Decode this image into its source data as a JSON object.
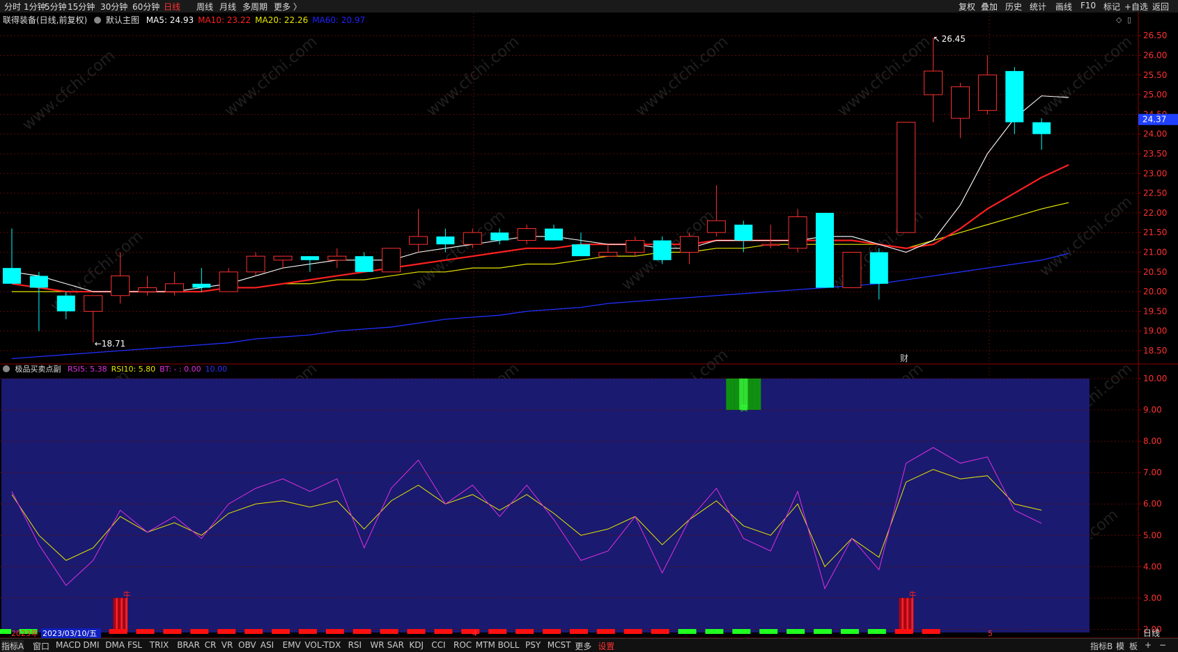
{
  "top_toolbar": {
    "periods": [
      "分时",
      "1分钟",
      "5分钟",
      "15分钟",
      "30分钟",
      "60分钟",
      "日线",
      "周线",
      "月线",
      "多周期",
      "更多 〉"
    ],
    "active_period": "日线",
    "right_tools": [
      "复权",
      "叠加",
      "历史",
      "统计",
      "画线",
      "F10",
      "标记",
      "+自选",
      "返回"
    ]
  },
  "main_panel": {
    "title": "联得装备(日线,前复权)",
    "indicator_name": "默认主图",
    "ma": [
      {
        "label": "MA5: 24.93",
        "color": "#ffffff"
      },
      {
        "label": "MA10: 23.22",
        "color": "#ff2020"
      },
      {
        "label": "MA20: 22.26",
        "color": "#e8e800"
      },
      {
        "label": "MA60: 20.97",
        "color": "#2020ff"
      }
    ],
    "high_label": "26.45",
    "low_label": "18.71",
    "price_tag": "24.37",
    "event_marker": "财",
    "y_ticks": [
      "26.50",
      "26.00",
      "25.50",
      "25.00",
      "24.50",
      "24.00",
      "23.50",
      "23.00",
      "22.50",
      "22.00",
      "21.50",
      "21.00",
      "20.50",
      "20.00",
      "19.50",
      "19.00",
      "18.50"
    ]
  },
  "sub_panel": {
    "title": "极品买卖点副",
    "values": [
      {
        "label": "RSI5: 5.38",
        "color": "#e030e0"
      },
      {
        "label": "RSI10: 5.80",
        "color": "#e8e800"
      },
      {
        "label": "BT: - : 0.00",
        "color": "#e030e0"
      },
      {
        "label": "10.00",
        "color": "#3030ff"
      }
    ],
    "y_ticks": [
      "10.00",
      "9.00",
      "8.00",
      "7.00",
      "6.00",
      "5.00",
      "4.00",
      "3.00",
      "2.00"
    ],
    "signal_labels": [
      "牛",
      "牛",
      "卖"
    ]
  },
  "time_axis": {
    "year": "2023年",
    "date": "2023/03/10/五",
    "month_marks": [
      "4",
      "5"
    ],
    "period_label": "日线"
  },
  "bottom_tabs": [
    "指标A",
    "窗口",
    "MACD",
    "DMI",
    "DMA",
    "FSL",
    "TRIX",
    "BRAR",
    "CR",
    "VR",
    "OBV",
    "ASI",
    "EMV",
    "VOL-TDX",
    "RSI",
    "WR",
    "SAR",
    "KDJ",
    "CCI",
    "ROC",
    "MTM",
    "BOLL",
    "PSY",
    "MCST",
    "更多",
    "设置"
  ],
  "bottom_right": [
    "指标B",
    "模",
    "板",
    "+",
    "−"
  ],
  "watermark": "www.cfchi.com",
  "chart_data": {
    "type": "candlestick",
    "dates_visible": [
      "2023/03/10"
    ],
    "candles": [
      {
        "o": 20.6,
        "h": 21.6,
        "l": 20.3,
        "c": 20.2
      },
      {
        "o": 20.4,
        "h": 20.5,
        "l": 19.0,
        "c": 20.1
      },
      {
        "o": 19.9,
        "h": 20.0,
        "l": 19.3,
        "c": 19.5
      },
      {
        "o": 19.5,
        "h": 19.9,
        "l": 18.71,
        "c": 19.9
      },
      {
        "o": 19.9,
        "h": 21.0,
        "l": 19.7,
        "c": 20.4
      },
      {
        "o": 20.0,
        "h": 20.4,
        "l": 19.9,
        "c": 20.1
      },
      {
        "o": 20.0,
        "h": 20.5,
        "l": 19.9,
        "c": 20.2
      },
      {
        "o": 20.2,
        "h": 20.6,
        "l": 20.0,
        "c": 20.1
      },
      {
        "o": 20.0,
        "h": 20.6,
        "l": 20.0,
        "c": 20.5
      },
      {
        "o": 20.5,
        "h": 21.0,
        "l": 20.4,
        "c": 20.9
      },
      {
        "o": 20.8,
        "h": 20.9,
        "l": 20.6,
        "c": 20.9
      },
      {
        "o": 20.9,
        "h": 20.9,
        "l": 20.5,
        "c": 20.8
      },
      {
        "o": 20.8,
        "h": 21.1,
        "l": 20.6,
        "c": 20.9
      },
      {
        "o": 20.9,
        "h": 21.0,
        "l": 20.5,
        "c": 20.5
      },
      {
        "o": 20.5,
        "h": 21.1,
        "l": 20.5,
        "c": 21.1
      },
      {
        "o": 21.2,
        "h": 22.1,
        "l": 21.0,
        "c": 21.4
      },
      {
        "o": 21.4,
        "h": 21.6,
        "l": 21.0,
        "c": 21.2
      },
      {
        "o": 21.2,
        "h": 21.6,
        "l": 21.1,
        "c": 21.5
      },
      {
        "o": 21.5,
        "h": 21.6,
        "l": 21.2,
        "c": 21.3
      },
      {
        "o": 21.3,
        "h": 21.7,
        "l": 21.2,
        "c": 21.6
      },
      {
        "o": 21.6,
        "h": 21.7,
        "l": 21.3,
        "c": 21.3
      },
      {
        "o": 21.2,
        "h": 21.5,
        "l": 20.9,
        "c": 20.9
      },
      {
        "o": 20.9,
        "h": 21.2,
        "l": 20.9,
        "c": 21.0
      },
      {
        "o": 21.0,
        "h": 21.4,
        "l": 20.9,
        "c": 21.3
      },
      {
        "o": 21.3,
        "h": 21.4,
        "l": 20.7,
        "c": 20.8
      },
      {
        "o": 21.0,
        "h": 21.5,
        "l": 20.7,
        "c": 21.4
      },
      {
        "o": 21.5,
        "h": 22.7,
        "l": 21.4,
        "c": 21.8
      },
      {
        "o": 21.7,
        "h": 21.8,
        "l": 21.0,
        "c": 21.3
      },
      {
        "o": 21.2,
        "h": 21.7,
        "l": 21.1,
        "c": 21.2
      },
      {
        "o": 21.1,
        "h": 22.1,
        "l": 21.0,
        "c": 21.9
      },
      {
        "o": 22.0,
        "h": 22.0,
        "l": 20.1,
        "c": 20.1
      },
      {
        "o": 20.1,
        "h": 21.0,
        "l": 20.1,
        "c": 21.0
      },
      {
        "o": 21.0,
        "h": 21.1,
        "l": 19.8,
        "c": 20.2
      },
      {
        "o": 21.5,
        "h": 24.3,
        "l": 21.5,
        "c": 24.3
      },
      {
        "o": 25.0,
        "h": 26.45,
        "l": 24.3,
        "c": 25.6
      },
      {
        "o": 24.4,
        "h": 25.3,
        "l": 23.9,
        "c": 25.2
      },
      {
        "o": 24.6,
        "h": 26.0,
        "l": 24.5,
        "c": 25.5
      },
      {
        "o": 25.6,
        "h": 25.7,
        "l": 24.0,
        "c": 24.3
      },
      {
        "o": 24.3,
        "h": 24.4,
        "l": 23.6,
        "c": 24.0
      }
    ],
    "ma5": [
      20.5,
      20.4,
      20.2,
      20.0,
      20.0,
      20.0,
      20.0,
      20.1,
      20.2,
      20.4,
      20.6,
      20.7,
      20.8,
      20.8,
      20.8,
      21.0,
      21.1,
      21.2,
      21.3,
      21.4,
      21.4,
      21.3,
      21.2,
      21.2,
      21.1,
      21.1,
      21.3,
      21.3,
      21.3,
      21.3,
      21.4,
      21.4,
      21.2,
      21.0,
      21.3,
      22.2,
      23.5,
      24.4,
      24.97,
      24.93
    ],
    "ma10": [
      20.2,
      20.1,
      20.0,
      20.0,
      20.0,
      20.0,
      20.0,
      20.0,
      20.1,
      20.1,
      20.2,
      20.3,
      20.4,
      20.5,
      20.6,
      20.7,
      20.8,
      20.9,
      21.0,
      21.1,
      21.1,
      21.2,
      21.2,
      21.2,
      21.2,
      21.2,
      21.3,
      21.3,
      21.3,
      21.3,
      21.3,
      21.3,
      21.2,
      21.1,
      21.2,
      21.6,
      22.1,
      22.5,
      22.9,
      23.22
    ],
    "ma20": [
      20.0,
      20.0,
      20.0,
      20.0,
      20.0,
      20.0,
      20.0,
      20.0,
      20.1,
      20.1,
      20.2,
      20.2,
      20.3,
      20.3,
      20.4,
      20.5,
      20.5,
      20.6,
      20.6,
      20.7,
      20.7,
      20.8,
      20.9,
      20.9,
      21.0,
      21.0,
      21.1,
      21.1,
      21.2,
      21.2,
      21.2,
      21.2,
      21.2,
      21.1,
      21.3,
      21.5,
      21.7,
      21.9,
      22.1,
      22.26
    ],
    "ma60": [
      18.3,
      18.35,
      18.4,
      18.45,
      18.5,
      18.55,
      18.6,
      18.65,
      18.7,
      18.8,
      18.85,
      18.9,
      19.0,
      19.05,
      19.1,
      19.2,
      19.3,
      19.35,
      19.4,
      19.5,
      19.55,
      19.6,
      19.7,
      19.75,
      19.8,
      19.85,
      19.9,
      19.95,
      20.0,
      20.05,
      20.1,
      20.15,
      20.2,
      20.3,
      20.4,
      20.5,
      20.6,
      20.7,
      20.8,
      20.97
    ],
    "rsi5": [
      6.4,
      4.7,
      3.4,
      4.2,
      5.8,
      5.1,
      5.6,
      4.9,
      6.0,
      6.5,
      6.8,
      6.4,
      6.8,
      4.6,
      6.5,
      7.4,
      6.0,
      6.6,
      5.6,
      6.6,
      5.5,
      4.2,
      4.5,
      5.6,
      3.8,
      5.5,
      6.5,
      4.9,
      4.5,
      6.4,
      3.3,
      4.9,
      3.9,
      7.3,
      7.8,
      7.3,
      7.5,
      5.8,
      5.38
    ],
    "rsi10": [
      6.3,
      5.0,
      4.2,
      4.6,
      5.6,
      5.1,
      5.4,
      5.0,
      5.7,
      6.0,
      6.1,
      5.9,
      6.1,
      5.2,
      6.1,
      6.6,
      6.0,
      6.3,
      5.8,
      6.3,
      5.7,
      5.0,
      5.2,
      5.6,
      4.7,
      5.5,
      6.1,
      5.3,
      5.0,
      6.0,
      4.0,
      4.9,
      4.3,
      6.7,
      7.1,
      6.8,
      6.9,
      6.0,
      5.8
    ],
    "signal_bars": [
      {
        "index": 4,
        "value": 3.0
      },
      {
        "index": 33,
        "value": 3.0
      }
    ],
    "sell_box": {
      "index": 27
    },
    "dot_colors": [
      "g",
      "g",
      "g",
      "g",
      "r",
      "r",
      "r",
      "r",
      "r",
      "r",
      "r",
      "r",
      "r",
      "r",
      "r",
      "r",
      "r",
      "r",
      "r",
      "r",
      "r",
      "r",
      "r",
      "r",
      "r",
      "r",
      "g",
      "g",
      "g",
      "g",
      "g",
      "g",
      "g",
      "g",
      "r",
      "r"
    ],
    "price_ylim": [
      18.2,
      26.75
    ],
    "sub_ylim": [
      1.9,
      10.0
    ]
  }
}
